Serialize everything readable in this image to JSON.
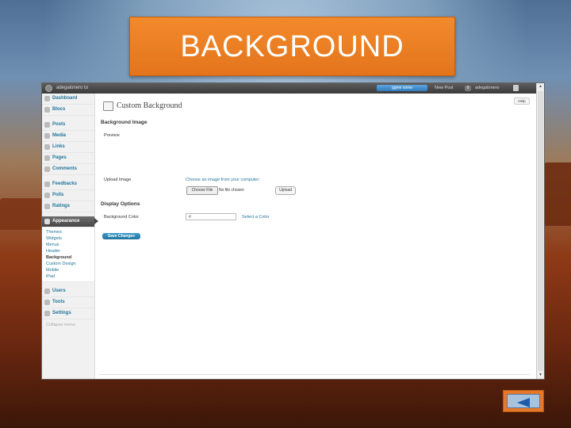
{
  "slide": {
    "title": "BACKGROUND"
  },
  "adminbar": {
    "site_name": "adegalonero to",
    "visit_site": "ggme some",
    "new_post": "New Post",
    "count": "0",
    "user": "adegalonero"
  },
  "sidebar": {
    "top_items": [
      {
        "label": "Dashboard",
        "icon": "dashboard-icon"
      },
      {
        "label": "Blocs",
        "icon": "blocs-icon"
      }
    ],
    "items": [
      {
        "label": "Posts",
        "icon": "pin-icon"
      },
      {
        "label": "Media",
        "icon": "media-icon"
      },
      {
        "label": "Links",
        "icon": "link-icon"
      },
      {
        "label": "Pages",
        "icon": "page-icon"
      },
      {
        "label": "Comments",
        "icon": "comment-icon"
      }
    ],
    "items2": [
      {
        "label": "Feedbacks",
        "icon": "feedback-icon"
      },
      {
        "label": "Polls",
        "icon": "poll-icon"
      },
      {
        "label": "Ratings",
        "icon": "rating-icon"
      }
    ],
    "appearance": {
      "label": "Appearance",
      "icon": "appearance-icon"
    },
    "appearance_sub": [
      "Themes",
      "Widgets",
      "Menus",
      "Header",
      "Background",
      "Custom Design",
      "Mobile",
      "iPad"
    ],
    "items3": [
      {
        "label": "Users",
        "icon": "users-icon"
      },
      {
        "label": "Tools",
        "icon": "tools-icon"
      },
      {
        "label": "Settings",
        "icon": "settings-icon"
      }
    ],
    "collapse": "Collapse menu"
  },
  "main": {
    "help": "Help",
    "page_title": "Custom Background",
    "section_image": "Background Image",
    "preview_label": "Preview",
    "upload_label": "Upload Image",
    "upload_hint": "Choose an image from your computer:",
    "choose_file": "Choose File",
    "no_file": "No file chosen",
    "upload_button": "Upload",
    "section_display": "Display Options",
    "color_label": "Background Color",
    "color_value": "#",
    "select_color": "Select a Color",
    "save_button": "Save Changes"
  },
  "colors": {
    "banner": "#e4741c",
    "link": "#21759b",
    "save_button": "#21759b"
  }
}
